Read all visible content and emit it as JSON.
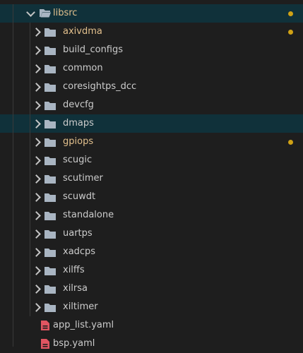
{
  "explorer": {
    "root": {
      "label": "libsrc",
      "modified": true,
      "expanded": true
    },
    "folders": [
      {
        "label": "axivdma",
        "modified": true
      },
      {
        "label": "build_configs",
        "modified": false
      },
      {
        "label": "common",
        "modified": false
      },
      {
        "label": "coresightps_dcc",
        "modified": false
      },
      {
        "label": "devcfg",
        "modified": false
      },
      {
        "label": "dmaps",
        "modified": false,
        "selected": true
      },
      {
        "label": "gpiops",
        "modified": true
      },
      {
        "label": "scugic",
        "modified": false
      },
      {
        "label": "scutimer",
        "modified": false
      },
      {
        "label": "scuwdt",
        "modified": false
      },
      {
        "label": "standalone",
        "modified": false
      },
      {
        "label": "uartps",
        "modified": false
      },
      {
        "label": "xadcps",
        "modified": false
      },
      {
        "label": "xilffs",
        "modified": false
      },
      {
        "label": "xilrsa",
        "modified": false
      },
      {
        "label": "xiltimer",
        "modified": false
      }
    ],
    "files": [
      {
        "label": "app_list.yaml",
        "icon": "yaml-file-icon"
      },
      {
        "label": "bsp.yaml",
        "icon": "yaml-file-icon"
      }
    ],
    "colors": {
      "background": "#1e1e1e",
      "selected_row": "#10313a",
      "modified_text": "#e2c08d",
      "modified_dot": "#d0a215",
      "folder_icon": "#a9b5c2",
      "yaml_icon": "#e05561"
    }
  }
}
